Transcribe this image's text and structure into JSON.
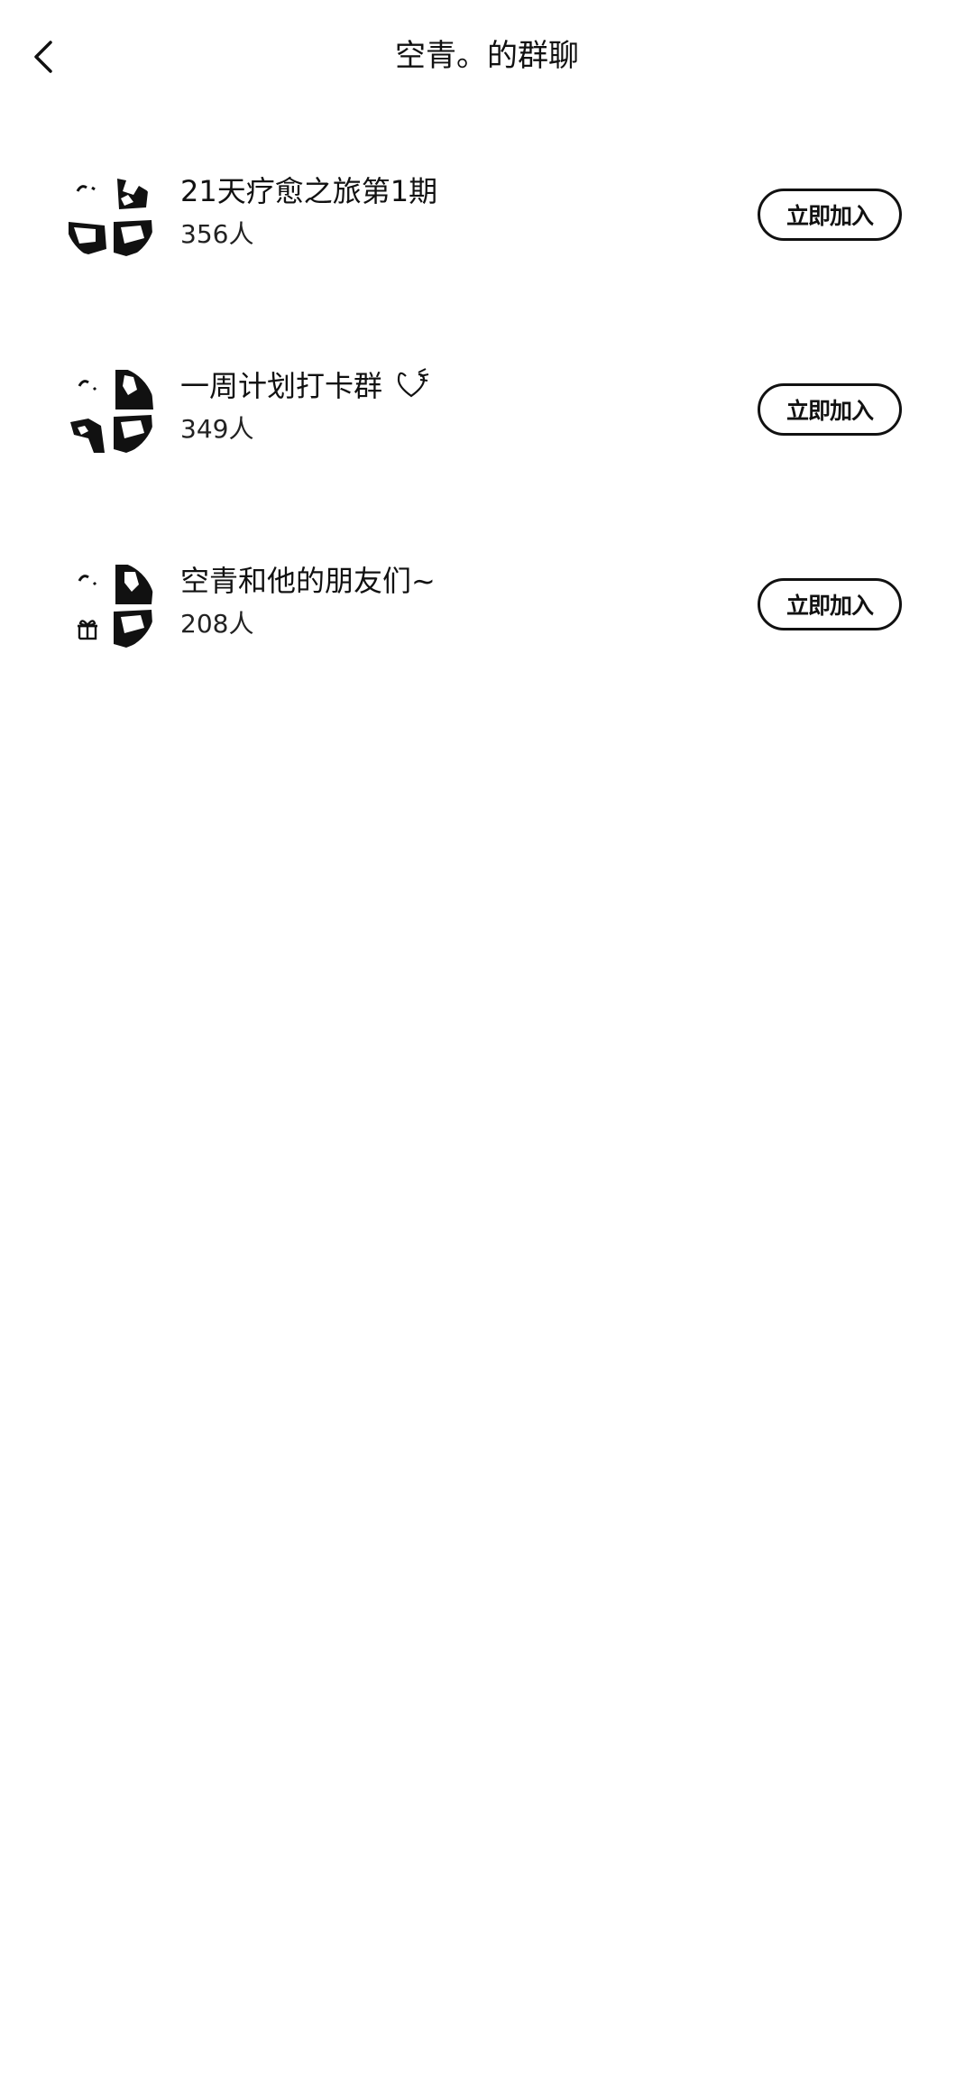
{
  "header": {
    "back_icon": "chevron-left-icon",
    "title": "空青。的群聊"
  },
  "groups": [
    {
      "name": "21天疗愈之旅第1期",
      "count": "356人",
      "join_label": "立即加入"
    },
    {
      "name": "一周计划打卡群",
      "emoji": "heart-with-wing-icon",
      "count": "349人",
      "join_label": "立即加入"
    },
    {
      "name": "空青和他的朋友们~",
      "count": "208人",
      "join_label": "立即加入"
    }
  ],
  "colors": {
    "text": "#111111",
    "background": "#ffffff"
  }
}
